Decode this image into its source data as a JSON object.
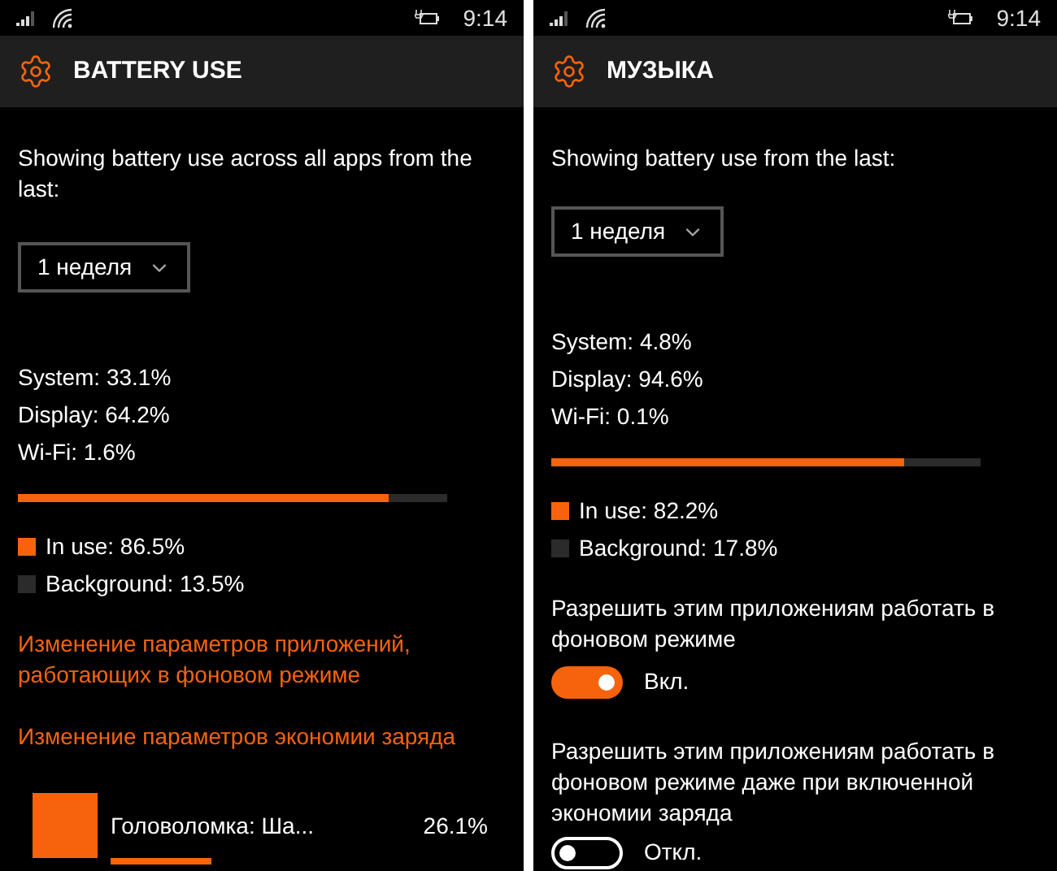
{
  "screens": [
    {
      "status_bar": {
        "time": "9:14"
      },
      "header": {
        "title": "BATTERY USE"
      },
      "intro": "Showing battery use across all apps from the last:",
      "period": {
        "value": "1 неделя"
      },
      "stats": [
        "System: 33.1%",
        "Display: 64.2%",
        "Wi-Fi: 1.6%"
      ],
      "usage_bar": {
        "level": 0.865
      },
      "legend": [
        {
          "label": "In use: 86.5%",
          "color": "#f7630c"
        },
        {
          "label": "Background: 13.5%",
          "color": "#2b2b2b"
        }
      ],
      "sections": [
        {
          "kind": "link",
          "text": "Изменение параметров приложений, работающих в фоновом режиме"
        },
        {
          "kind": "link",
          "text": "Изменение параметров экономии заряда"
        },
        {
          "kind": "app",
          "name": "Головоломка: Ша...",
          "percent": "26.1%"
        }
      ]
    },
    {
      "status_bar": {
        "time": "9:14"
      },
      "header": {
        "title": "МУЗЫКА"
      },
      "intro": "Showing battery use from the last:",
      "period": {
        "value": "1 неделя"
      },
      "stats": [
        "System: 4.8%",
        "Display: 94.6%",
        "Wi-Fi: 0.1%"
      ],
      "usage_bar": {
        "level": 0.822
      },
      "legend": [
        {
          "label": "In use: 82.2%",
          "color": "#f7630c"
        },
        {
          "label": "Background: 17.8%",
          "color": "#2b2b2b"
        }
      ],
      "sections": [
        {
          "kind": "toggle",
          "text": "Разрешить этим приложениям работать в фоновом режиме",
          "on": true,
          "state_label": "Вкл."
        },
        {
          "kind": "toggle",
          "text": "Разрешить этим приложениям работать в фоновом режиме даже при включенной экономии заряда",
          "on": false,
          "state_label": "Откл."
        }
      ]
    }
  ]
}
